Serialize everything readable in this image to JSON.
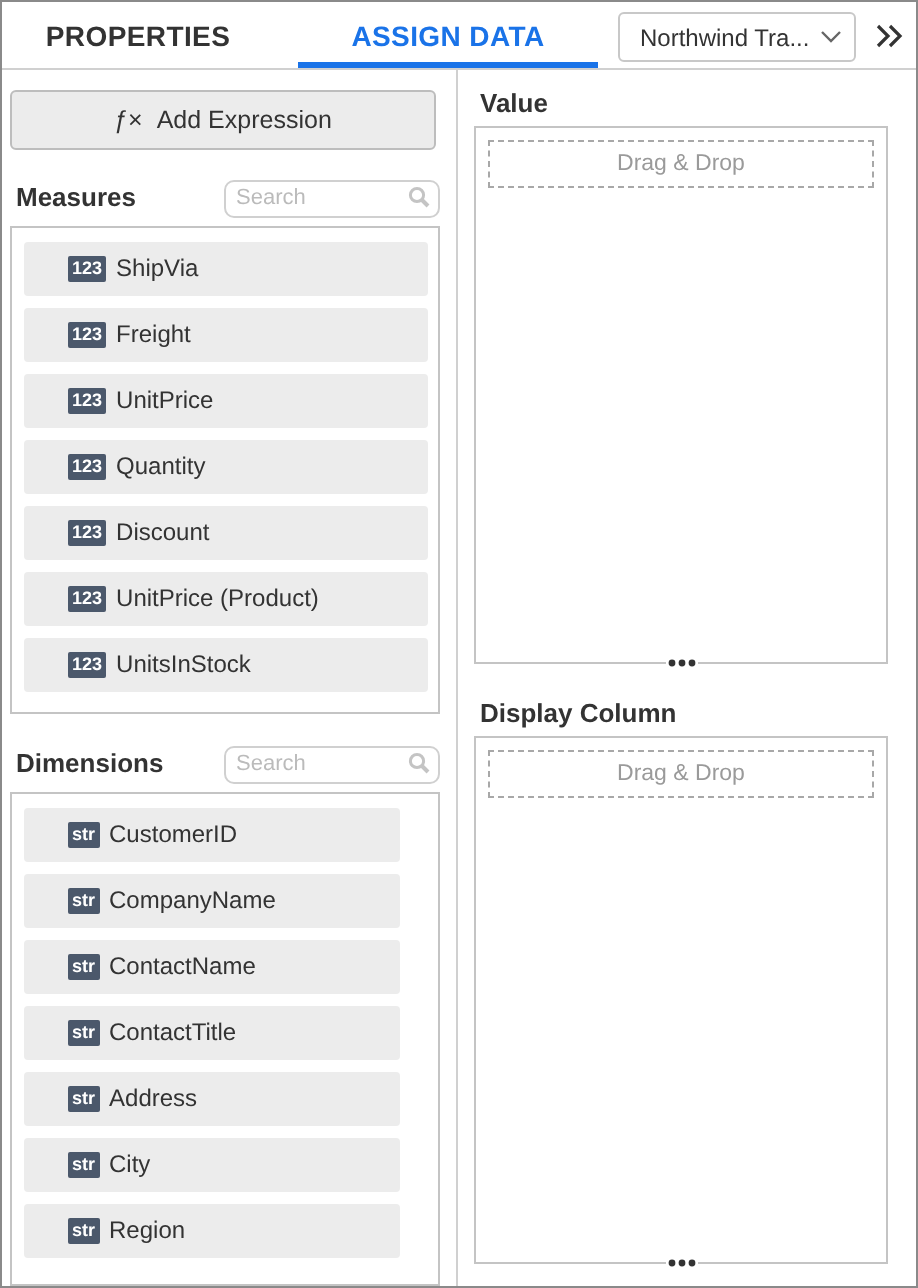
{
  "tabs": [
    {
      "label": "PROPERTIES",
      "selected": false
    },
    {
      "label": "ASSIGN DATA",
      "selected": true
    }
  ],
  "datasource": {
    "value": "Northwind Tra..."
  },
  "add_expression": {
    "icon_text": "ƒ×",
    "label": "Add Expression"
  },
  "measures": {
    "title": "Measures",
    "search": {
      "placeholder": "Search"
    },
    "items": [
      {
        "badge": "123",
        "label": "ShipVia"
      },
      {
        "badge": "123",
        "label": "Freight"
      },
      {
        "badge": "123",
        "label": "UnitPrice"
      },
      {
        "badge": "123",
        "label": "Quantity"
      },
      {
        "badge": "123",
        "label": "Discount"
      },
      {
        "badge": "123",
        "label": "UnitPrice (Product)"
      },
      {
        "badge": "123",
        "label": "UnitsInStock"
      }
    ]
  },
  "dimensions": {
    "title": "Dimensions",
    "search": {
      "placeholder": "Search"
    },
    "items": [
      {
        "badge": "str",
        "label": "CustomerID"
      },
      {
        "badge": "str",
        "label": "CompanyName"
      },
      {
        "badge": "str",
        "label": "ContactName"
      },
      {
        "badge": "str",
        "label": "ContactTitle"
      },
      {
        "badge": "str",
        "label": "Address"
      },
      {
        "badge": "str",
        "label": "City"
      },
      {
        "badge": "str",
        "label": "Region"
      }
    ]
  },
  "drop_zones": [
    {
      "title": "Value",
      "hint": "Drag & Drop"
    },
    {
      "title": "Display Column",
      "hint": "Drag & Drop"
    }
  ]
}
